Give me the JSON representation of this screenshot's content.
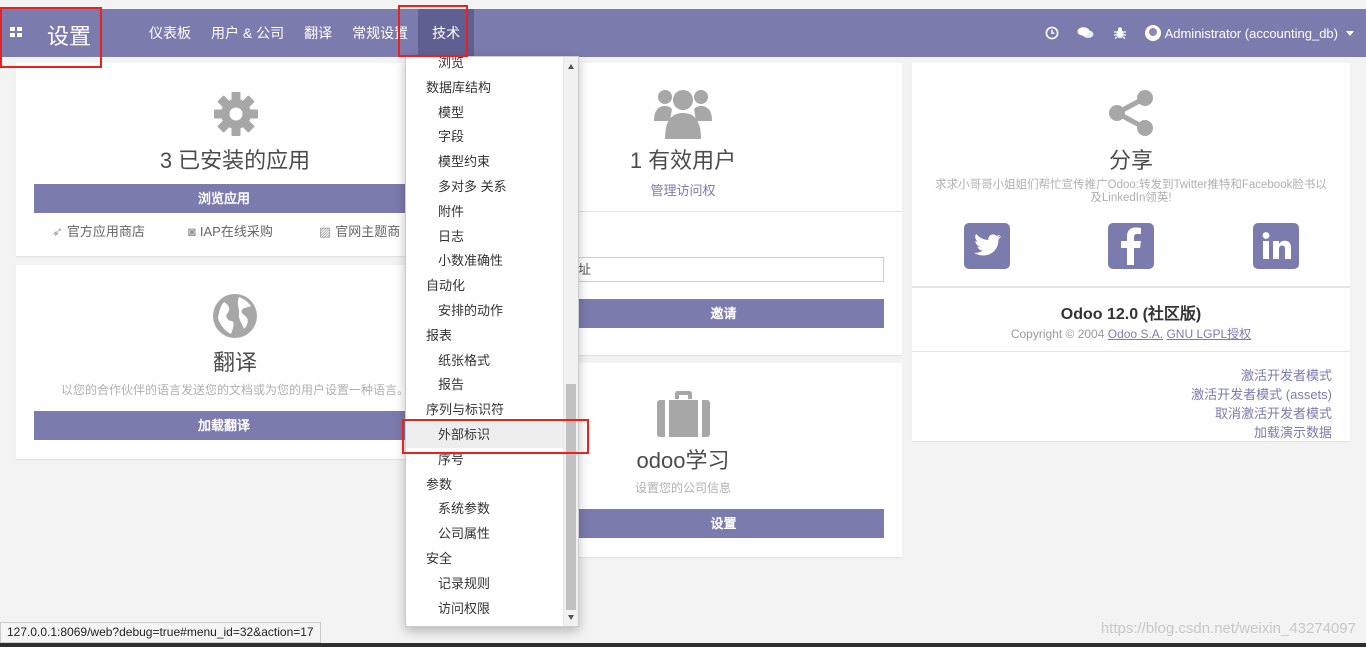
{
  "app": {
    "title": "设置"
  },
  "menu": [
    {
      "label": "仪表板"
    },
    {
      "label": "用户 & 公司"
    },
    {
      "label": "翻译"
    },
    {
      "label": "常规设置"
    },
    {
      "label": "技术"
    }
  ],
  "systray": {
    "user": "Administrator (accounting_db)"
  },
  "apps_card": {
    "count_text": "3 已安装的应用",
    "browse_button": "浏览应用",
    "links": [
      "官方应用商店",
      "IAP在线采购",
      "官网主题商"
    ]
  },
  "translate_card": {
    "title": "翻译",
    "description": "以您的合作伙伴的语言发送您的文档或为您的用户设置一种语言。",
    "button": "加载翻译"
  },
  "users_card": {
    "count_text": "1 有效用户",
    "manage_link": "管理访问权",
    "email_placeholder": "址",
    "invite_button": "邀请"
  },
  "company_card": {
    "title": "odoo学习",
    "description": "设置您的公司信息",
    "button": "设置"
  },
  "share_card": {
    "title": "分享",
    "description": "求求小哥哥小姐姐们帮忙宣传推广Odoo:转发到Twitter推特和Facebook脸书以及LinkedIn领英!",
    "social": [
      "twitter",
      "facebook",
      "linkedin"
    ]
  },
  "about_card": {
    "version": "Odoo 12.0 (社区版)",
    "copyright_prefix": "Copyright © 2004 ",
    "company_link": "Odoo S.A.",
    "license_link": "GNU LGPL授权",
    "dev_links": [
      "激活开发者模式",
      "激活开发者模式 (assets)",
      "取消激活开发者模式",
      "加载演示数据"
    ]
  },
  "dropdown": {
    "items": [
      {
        "label": "浏览",
        "type": "sub"
      },
      {
        "label": "数据库结构",
        "type": "header"
      },
      {
        "label": "模型",
        "type": "sub"
      },
      {
        "label": "字段",
        "type": "sub"
      },
      {
        "label": "模型约束",
        "type": "sub"
      },
      {
        "label": "多对多 关系",
        "type": "sub"
      },
      {
        "label": "附件",
        "type": "sub"
      },
      {
        "label": "日志",
        "type": "sub"
      },
      {
        "label": "小数准确性",
        "type": "sub"
      },
      {
        "label": "自动化",
        "type": "header"
      },
      {
        "label": "安排的动作",
        "type": "sub"
      },
      {
        "label": "报表",
        "type": "header"
      },
      {
        "label": "纸张格式",
        "type": "sub"
      },
      {
        "label": "报告",
        "type": "sub"
      },
      {
        "label": "序列与标识符",
        "type": "header"
      },
      {
        "label": "外部标识",
        "type": "sub"
      },
      {
        "label": "序号",
        "type": "sub"
      },
      {
        "label": "参数",
        "type": "header"
      },
      {
        "label": "系统参数",
        "type": "sub"
      },
      {
        "label": "公司属性",
        "type": "sub"
      },
      {
        "label": "安全",
        "type": "header"
      },
      {
        "label": "记录规则",
        "type": "sub"
      },
      {
        "label": "访问权限",
        "type": "sub"
      }
    ]
  },
  "status_url": "127.0.0.1:8069/web?debug=true#menu_id=32&action=17",
  "watermark": "https://blog.csdn.net/weixin_43274097",
  "colors": {
    "primary": "#7c7bad",
    "highlight": "#e8231f"
  }
}
